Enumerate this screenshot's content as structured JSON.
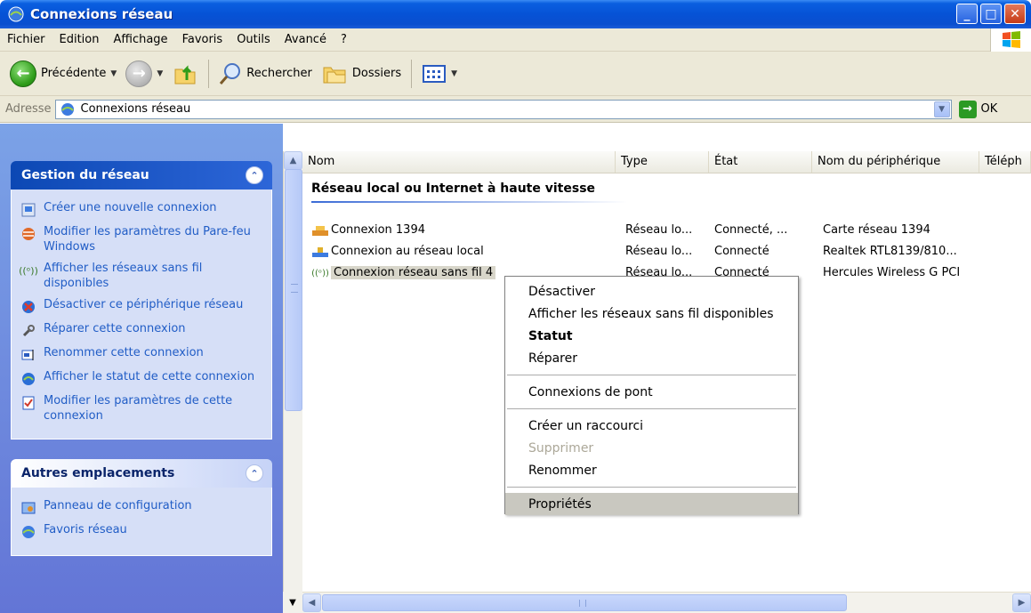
{
  "window": {
    "title": "Connexions réseau"
  },
  "menubar": {
    "items": [
      "Fichier",
      "Edition",
      "Affichage",
      "Favoris",
      "Outils",
      "Avancé",
      "?"
    ]
  },
  "toolbar": {
    "back_label": "Précédente",
    "search_label": "Rechercher",
    "folders_label": "Dossiers"
  },
  "address": {
    "label": "Adresse",
    "value": "Connexions réseau",
    "go_label": "OK"
  },
  "taskpane": {
    "network_tasks": {
      "title": "Gestion du réseau",
      "items": [
        {
          "label": "Créer une nouvelle connexion",
          "icon": "new-connection-icon"
        },
        {
          "label": "Modifier les paramètres du Pare-feu Windows",
          "icon": "firewall-icon"
        },
        {
          "label": "Afficher les réseaux sans fil disponibles",
          "icon": "wireless-icon"
        },
        {
          "label": "Désactiver ce périphérique réseau",
          "icon": "disable-device-icon"
        },
        {
          "label": "Réparer cette connexion",
          "icon": "repair-icon"
        },
        {
          "label": "Renommer cette connexion",
          "icon": "rename-icon"
        },
        {
          "label": "Afficher le statut de cette connexion",
          "icon": "status-icon"
        },
        {
          "label": "Modifier les paramètres de cette connexion",
          "icon": "settings-icon"
        }
      ]
    },
    "other_places": {
      "title": "Autres emplacements",
      "items": [
        {
          "label": "Panneau de configuration",
          "icon": "control-panel-icon"
        },
        {
          "label": "Favoris réseau",
          "icon": "network-places-icon"
        }
      ]
    }
  },
  "list": {
    "columns": [
      "Nom",
      "Type",
      "État",
      "Nom du périphérique",
      "Téléph"
    ],
    "group_title": "Réseau local ou Internet à haute vitesse",
    "rows": [
      {
        "name": "Connexion 1394",
        "type": "Réseau lo...",
        "state": "Connecté, ...",
        "device": "Carte réseau 1394",
        "icon": "connection-1394-icon"
      },
      {
        "name": "Connexion au réseau local",
        "type": "Réseau lo...",
        "state": "Connecté",
        "device": "Realtek RTL8139/810...",
        "icon": "lan-icon"
      },
      {
        "name": "Connexion réseau sans fil 4",
        "type": "Réseau lo...",
        "state": "Connecté",
        "device": "Hercules Wireless G PCI",
        "icon": "wireless-icon"
      }
    ]
  },
  "context_menu": {
    "items": [
      {
        "label": "Désactiver",
        "style": "normal"
      },
      {
        "label": "Afficher les réseaux sans fil disponibles",
        "style": "normal"
      },
      {
        "label": "Statut",
        "style": "bold"
      },
      {
        "label": "Réparer",
        "style": "normal"
      },
      {
        "label": "Connexions de pont",
        "style": "normal"
      },
      {
        "label": "Créer un raccourci",
        "style": "normal"
      },
      {
        "label": "Supprimer",
        "style": "disabled"
      },
      {
        "label": "Renommer",
        "style": "normal"
      },
      {
        "label": "Propriétés",
        "style": "highlighted"
      }
    ]
  },
  "colors": {
    "title_bar": "#0652d6",
    "task_pane": "#6375d6",
    "link": "#215dc6",
    "selection": "#c9c8c0"
  }
}
